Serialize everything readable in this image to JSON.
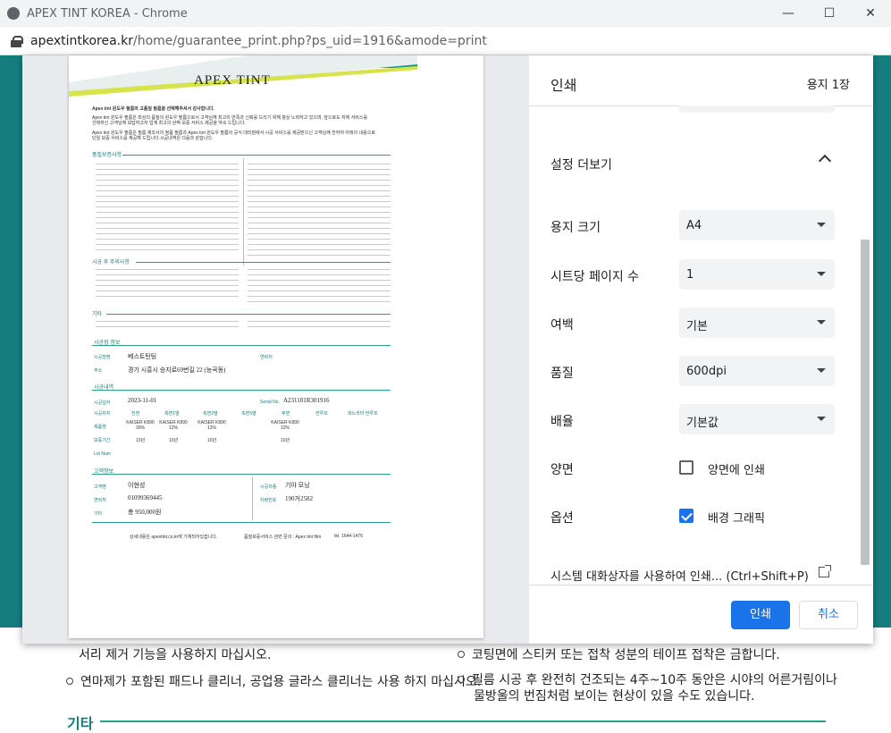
{
  "window": {
    "title": "APEX TINT KOREA - Chrome"
  },
  "address": {
    "host": "apextintkorea.kr",
    "path": "/home/guarantee_print.php?ps_uid=1916&amode=print"
  },
  "background": {
    "line1": "서리 제거 기능을 사용하지 마십시오.",
    "line2": "연마제가 포함된 패드나 클리너, 공업용 글라스 클리너는 사용 하지 마십시오.",
    "line3": "코팅면에 스티커 또는 접착 성분의 테이프 접착은 금합니다.",
    "line4": "필름 시공 후 완전히 건조되는 4주~10주 동안은 시야의 어른거림이나",
    "line5": "물방울의 번짐처럼 보이는 현상이 있을 수도 있습니다.",
    "section": "기타"
  },
  "print": {
    "title": "인쇄",
    "page_count": "용지 1장",
    "more_settings": "설정 더보기",
    "paper_size_label": "용지 크기",
    "paper_size_value": "A4",
    "pages_per_sheet_label": "시트당 페이지 수",
    "pages_per_sheet_value": "1",
    "margins_label": "여백",
    "margins_value": "기본",
    "quality_label": "품질",
    "quality_value": "600dpi",
    "scale_label": "배율",
    "scale_value": "기본값",
    "duplex_label": "양면",
    "duplex_option": "양면에 인쇄",
    "duplex_checked": false,
    "options_label": "옵션",
    "bg_graphics_option": "배경 그래픽",
    "bg_graphics_checked": true,
    "system_dialog": "시스템 대화상자를 사용하여 인쇄... (Ctrl+Shift+P)",
    "print_button": "인쇄",
    "cancel_button": "취소"
  },
  "doc": {
    "logo": "APEX TINT",
    "intro1": "Apex tint 윈도우 필름의 고품질 필름을 선택해주셔서 감사합니다.",
    "intro2": "Apex tint 윈도우 필름은 최상의 품질의 윈도우 필름으로서 고객님께 최고의 만족과 신뢰를 드리기 위해 항상 노력하고 있으며, 앞으로도 자체 서비스를",
    "intro3": "선택하신 고객님께 보답하고자 업계 최고의 완벽 보증 서비스 제공을 약속 드립니다.",
    "intro4": "Apex tint 윈도우 필름은 필름 제조사의 정품 필름과 Apex tint 윈도우 필름의 공식 대리점에서 시공 서비스를 제공받으신 고객님께 한하여 아래의 내용으로",
    "intro5": "단일 보증 서비스를 제공해 드립니다.시공내역은 다음과 같습니다.",
    "h_quality": "품질보증사항",
    "h_after": "시공 후 주의사항",
    "h_etc": "기타",
    "h_shop": "시공점 정보",
    "shop_label": "시공점명",
    "shop_value": "베스트틴팅",
    "shop_contact_label": "연락처",
    "addr_label": "주소",
    "addr_value": "경기 시흥시 승지로69번길 22 (능곡동)",
    "h_work": "시공내역",
    "date_label": "시공일자",
    "date_value": "2023-11-01",
    "serial_label": "Serial No.",
    "serial_value": "A231101R301916",
    "pos_label": "시공위치",
    "positions": [
      "전면",
      "측면1열",
      "측면2열",
      "측면3열",
      "후면",
      "썬루프",
      "파노라마 썬루프"
    ],
    "product_label": "제품명",
    "products": [
      "KAISER K890\n30%",
      "KAISER K890\n12%",
      "KAISER K890\n12%",
      "",
      "KAISER K890\n12%"
    ],
    "warranty_label": "보증기간",
    "warranties": [
      "10년",
      "10년",
      "10년",
      "",
      "10년"
    ],
    "lot_label": "Lot Num",
    "h_customer": "고객정보",
    "cust_label": "고객명",
    "cust_value": "이현성",
    "car_label": "시공차종",
    "car_value": "기아 모닝",
    "phone_label": "연락처",
    "phone_value": "01099369445",
    "plate_label": "차량번호",
    "plate_value": "190거2582",
    "etc_label": "기타",
    "etc_value": "총 950,000원",
    "footer1": "상세내용은 apextint.co.kr에 기재되어있습니다.",
    "footer2": "품질보증서비스 관련 문의 : Apex tint film",
    "footer3": "tel. 1644-1476"
  }
}
